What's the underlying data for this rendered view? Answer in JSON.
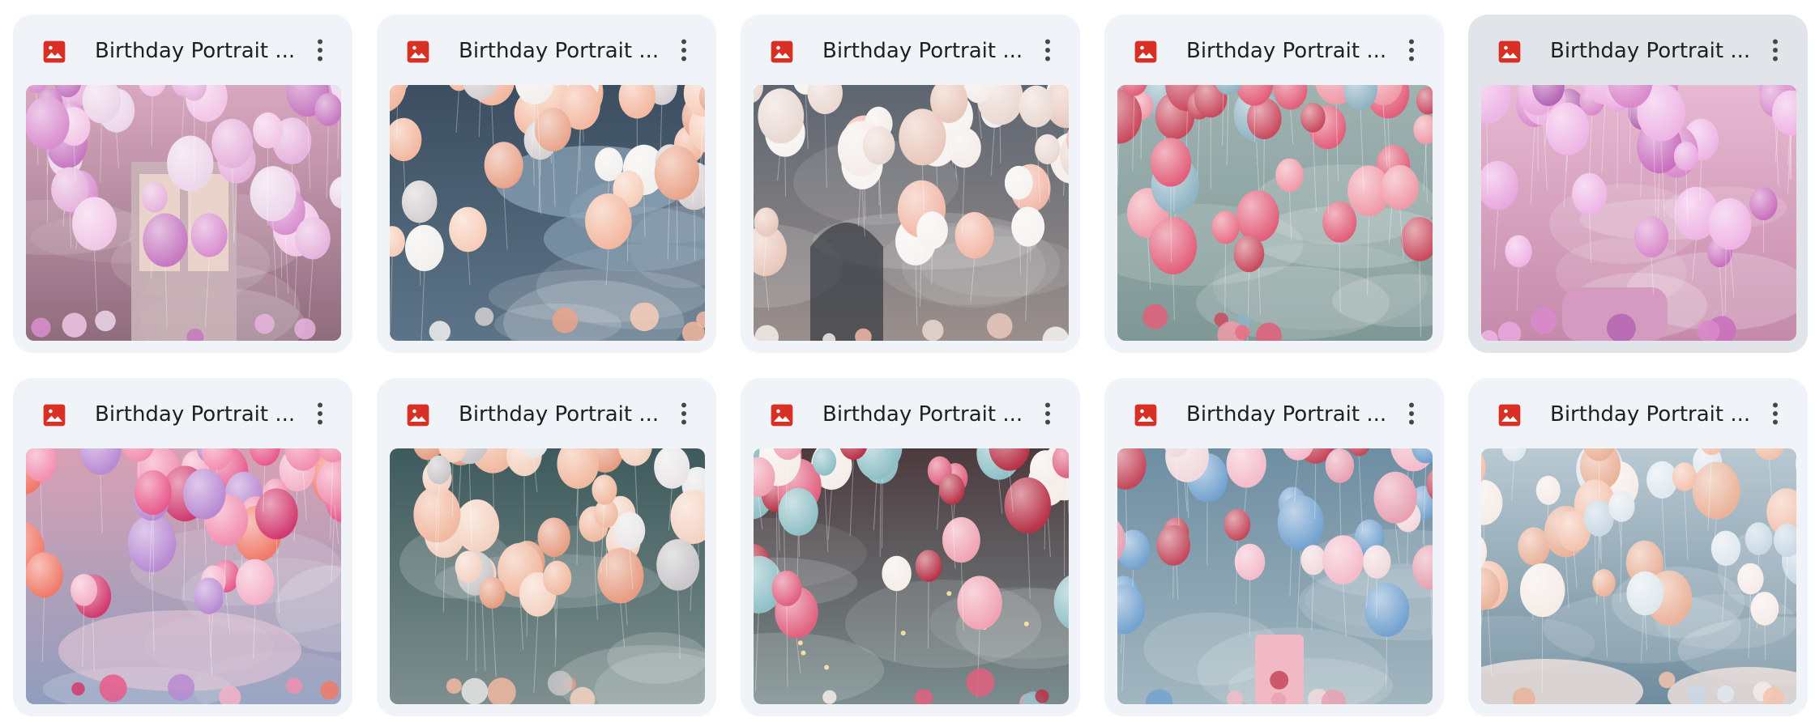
{
  "files": [
    {
      "title": "Birthday Portrait ...",
      "icon": "image-file-icon",
      "theme": "pink-door",
      "selected": false
    },
    {
      "title": "Birthday Portrait ...",
      "icon": "image-file-icon",
      "theme": "peach-clouds",
      "selected": false
    },
    {
      "title": "Birthday Portrait ...",
      "icon": "image-file-icon",
      "theme": "white-window",
      "selected": false
    },
    {
      "title": "Birthday Portrait ...",
      "icon": "image-file-icon",
      "theme": "red-teal-wall",
      "selected": false
    },
    {
      "title": "Birthday Portrait ...",
      "icon": "image-file-icon",
      "theme": "pink-room",
      "selected": true
    },
    {
      "title": "Birthday Portrait ...",
      "icon": "image-file-icon",
      "theme": "pink-heart-arch",
      "selected": false
    },
    {
      "title": "Birthday Portrait ...",
      "icon": "image-file-icon",
      "theme": "peach-stars",
      "selected": false
    },
    {
      "title": "Birthday Portrait ...",
      "icon": "image-file-icon",
      "theme": "mixed-lights",
      "selected": false
    },
    {
      "title": "Birthday Portrait ...",
      "icon": "image-file-icon",
      "theme": "blue-pink-cake",
      "selected": false
    },
    {
      "title": "Birthday Portrait ...",
      "icon": "image-file-icon",
      "theme": "pastel-sky",
      "selected": false
    }
  ],
  "colors": {
    "card_bg": "#f0f4f9",
    "card_selected_bg": "#e1e5ea",
    "image_icon": "#d93025",
    "title_text": "#1f1f1f",
    "more_icon": "#444746"
  }
}
